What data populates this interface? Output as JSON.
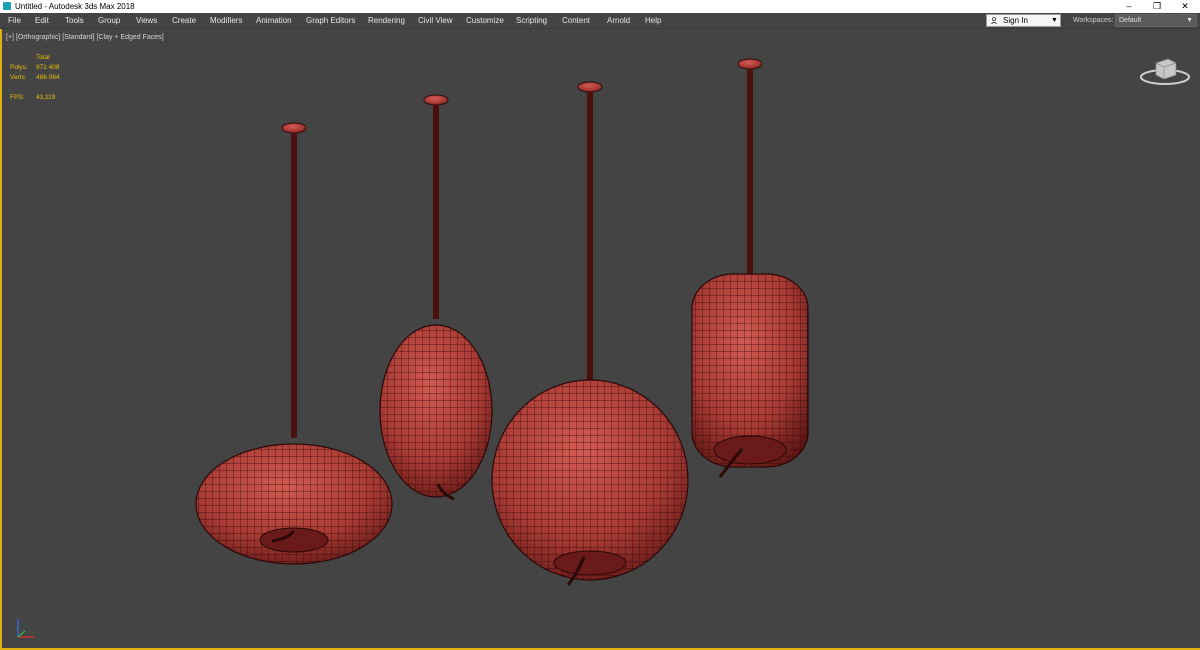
{
  "window": {
    "title": "Untitled - Autodesk 3ds Max 2018",
    "buttons": {
      "minimize": "–",
      "restore": "❐",
      "close": "✕"
    }
  },
  "menu": [
    "File",
    "Edit",
    "Tools",
    "Group",
    "Views",
    "Create",
    "Modifiers",
    "Animation",
    "Graph Editors",
    "Rendering",
    "Civil View",
    "Customize",
    "Scripting",
    "Content",
    "Arnold",
    "Help"
  ],
  "account": {
    "sign_in": "Sign In",
    "arrow": "▼"
  },
  "workspaces": {
    "label": "Workspaces:",
    "value": "Default",
    "arrow": "▼"
  },
  "viewport": {
    "label_parts": [
      "[+]",
      "[Orthographic]",
      "[Standard]",
      "[Clay + Edged Faces]"
    ],
    "stats": {
      "header": "Total",
      "polys_label": "Polys:",
      "polys_value": "971 408",
      "verts_label": "Verts:",
      "verts_value": "486 084",
      "fps_label": "FPS:",
      "fps_value": "43,119"
    }
  },
  "colors": {
    "accent": "#e0b010",
    "viewport_bg": "#444444",
    "clay": "#b4403a",
    "wire": "#2a0808"
  }
}
